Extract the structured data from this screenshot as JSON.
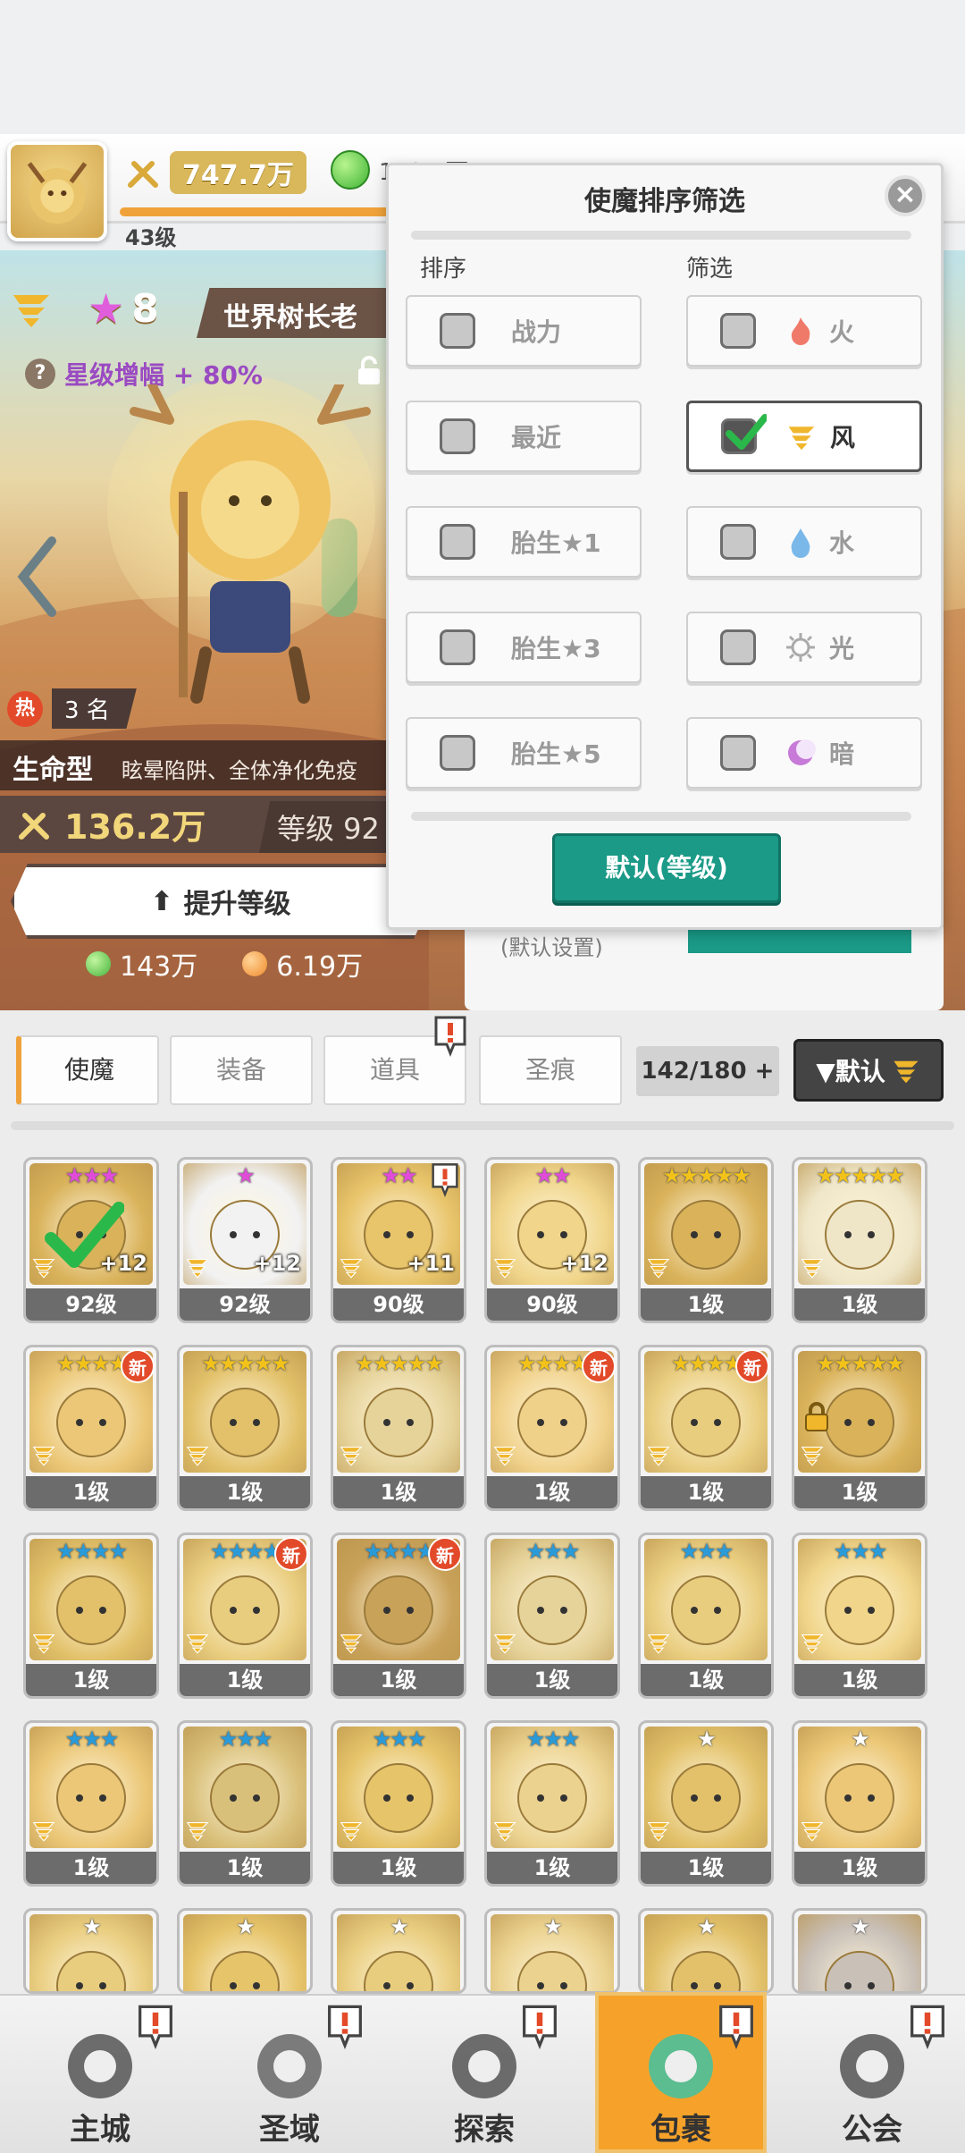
{
  "top_bar": {
    "avatar_level": "43级",
    "power": "747.7万",
    "gem_value": "149.7万"
  },
  "character": {
    "star_level": "8",
    "name": "世界树长老",
    "star_boost": "星级增幅 + 80%",
    "hot_rank": "3 名",
    "hot_icon": "热",
    "type_label": "生命型",
    "type_desc": "眩晕陷阱、全体净化免疫",
    "power": "136.2万",
    "level": "等级 92",
    "upgrade_label": "提升等级",
    "cost_green": "143万",
    "cost_orange": "6.19万"
  },
  "under_panel": {
    "default_setting": "(默认设置)"
  },
  "filter_popup": {
    "title": "使魔排序筛选",
    "sort_header": "排序",
    "filter_header": "筛选",
    "sort_options": [
      {
        "label": "战力",
        "checked": false
      },
      {
        "label": "最近",
        "checked": false
      },
      {
        "label": "胎生★1",
        "checked": false
      },
      {
        "label": "胎生★3",
        "checked": false
      },
      {
        "label": "胎生★5",
        "checked": false
      }
    ],
    "filter_options": [
      {
        "label": "火",
        "icon": "fire-icon",
        "checked": false
      },
      {
        "label": "风",
        "icon": "wind-icon",
        "checked": true
      },
      {
        "label": "水",
        "icon": "water-icon",
        "checked": false
      },
      {
        "label": "光",
        "icon": "light-icon",
        "checked": false
      },
      {
        "label": "暗",
        "icon": "dark-icon",
        "checked": false
      }
    ],
    "default_button": "默认(等级)",
    "close_symbol": "×"
  },
  "tabs": {
    "items": [
      "使魔",
      "装备",
      "道具",
      "圣痕"
    ],
    "count": "142/180",
    "count_plus": "+",
    "sort_label": "▼默认"
  },
  "grid": {
    "rows": [
      [
        {
          "stars": "★★★",
          "star_color": "#e04cd8",
          "level": "92级",
          "plus": "+12",
          "art": "#d9b25a"
        },
        {
          "stars": "★",
          "star_color": "#e04cd8",
          "level": "92级",
          "plus": "+12",
          "art": "#f2f2f2"
        },
        {
          "stars": "★★",
          "star_color": "#e04cd8",
          "level": "90级",
          "plus": "+11",
          "art": "#e8c46a"
        },
        {
          "stars": "★★",
          "star_color": "#e04cd8",
          "level": "90级",
          "plus": "+12",
          "art": "#f0d58a"
        },
        {
          "stars": "★★★★★",
          "star_color": "#f2c21a",
          "level": "1级",
          "plus": "",
          "art": "#d9b25a"
        },
        {
          "stars": "★★★★★",
          "star_color": "#f2c21a",
          "level": "1级",
          "plus": "",
          "art": "#efe6c8"
        }
      ],
      [
        {
          "stars": "★★★★",
          "star_color": "#f2c21a",
          "level": "1级",
          "plus": "",
          "art": "#ebc777"
        },
        {
          "stars": "★★★★★",
          "star_color": "#f2c21a",
          "level": "1级",
          "plus": "",
          "art": "#e2c16a"
        },
        {
          "stars": "★★★★★",
          "star_color": "#f2c21a",
          "level": "1级",
          "plus": "",
          "art": "#e6d39a"
        },
        {
          "stars": "★★★★",
          "star_color": "#f2c21a",
          "level": "1级",
          "plus": "",
          "art": "#f0d18a"
        },
        {
          "stars": "★★★★",
          "star_color": "#f2c21a",
          "level": "1级",
          "plus": "",
          "art": "#e9cd7f"
        },
        {
          "stars": "★★★★★",
          "star_color": "#f2c21a",
          "level": "1级",
          "plus": "",
          "art": "#d9b25a"
        }
      ],
      [
        {
          "stars": "★★★★",
          "star_color": "#2a9bd8",
          "level": "1级",
          "plus": "",
          "art": "#e2c16a"
        },
        {
          "stars": "★★★★",
          "star_color": "#2a9bd8",
          "level": "1级",
          "plus": "",
          "art": "#e9cd7f"
        },
        {
          "stars": "★★★★",
          "star_color": "#2a9bd8",
          "level": "1级",
          "plus": "",
          "art": "#c9a25a"
        },
        {
          "stars": "★★★",
          "star_color": "#2a9bd8",
          "level": "1级",
          "plus": "",
          "art": "#e6d39a"
        },
        {
          "stars": "★★★",
          "star_color": "#2a9bd8",
          "level": "1级",
          "plus": "",
          "art": "#e9cd7f"
        },
        {
          "stars": "★★★",
          "star_color": "#2a9bd8",
          "level": "1级",
          "plus": "",
          "art": "#f0d58a"
        }
      ],
      [
        {
          "stars": "★★★",
          "star_color": "#2a9bd8",
          "level": "1级",
          "plus": "",
          "art": "#ebc777"
        },
        {
          "stars": "★★★",
          "star_color": "#2a9bd8",
          "level": "1级",
          "plus": "",
          "art": "#d9c07a"
        },
        {
          "stars": "★★★",
          "star_color": "#2a9bd8",
          "level": "1级",
          "plus": "",
          "art": "#e6c46a"
        },
        {
          "stars": "★★★",
          "star_color": "#2a9bd8",
          "level": "1级",
          "plus": "",
          "art": "#ebd28f"
        },
        {
          "stars": "★",
          "star_color": "#ffffff",
          "level": "1级",
          "plus": "",
          "art": "#e2c16a"
        },
        {
          "stars": "★",
          "star_color": "#ffffff",
          "level": "1级",
          "plus": "",
          "art": "#ebc777"
        }
      ],
      [
        {
          "stars": "★",
          "star_color": "#ffffff",
          "level": "",
          "plus": "",
          "art": "#e9cd7f"
        },
        {
          "stars": "★",
          "star_color": "#ffffff",
          "level": "",
          "plus": "",
          "art": "#e6c46a"
        },
        {
          "stars": "★",
          "star_color": "#ffffff",
          "level": "",
          "plus": "",
          "art": "#e9cd7f"
        },
        {
          "stars": "★",
          "star_color": "#ffffff",
          "level": "",
          "plus": "",
          "art": "#ebd28f"
        },
        {
          "stars": "★",
          "star_color": "#ffffff",
          "level": "",
          "plus": "",
          "art": "#e2c16a"
        },
        {
          "stars": "★",
          "star_color": "#ffffff",
          "level": "",
          "plus": "",
          "art": "#c9c0b8"
        }
      ]
    ],
    "new_tag": "新"
  },
  "bottom_nav": {
    "items": [
      "主城",
      "圣域",
      "探索",
      "包裹",
      "公会"
    ],
    "active": "包裹"
  },
  "colors": {
    "teal": "#1a9a87",
    "orange_active": "#f6a22a",
    "star_pink": "#e04cd8"
  }
}
